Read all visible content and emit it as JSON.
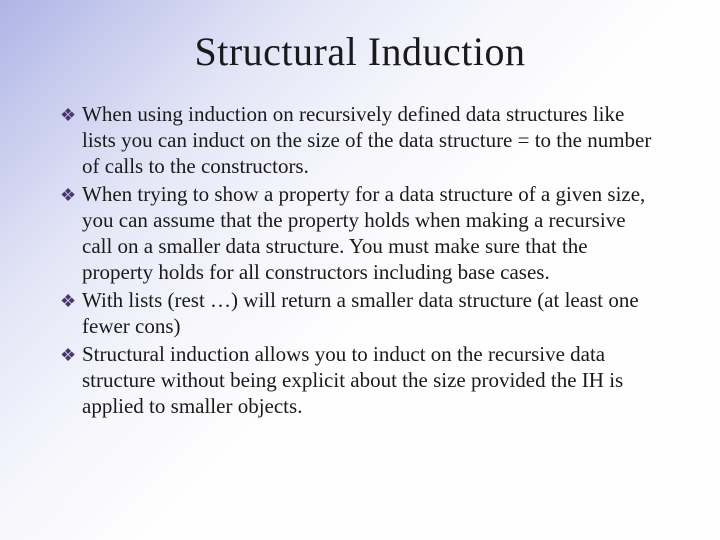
{
  "title": "Structural Induction",
  "bullets": [
    "When using induction on recursively defined data structures like lists you can induct on the size of the data structure = to the number of calls to the constructors.",
    "When trying to show a property for a data structure of a given size, you can assume that the property holds when making a recursive call on a smaller data structure.  You must make sure that the property holds for all constructors including base cases.",
    "With lists (rest …) will return a smaller data structure (at least one fewer cons)",
    "Structural induction allows you to induct on the recursive data structure without being explicit about the size provided the IH is applied to smaller objects."
  ]
}
